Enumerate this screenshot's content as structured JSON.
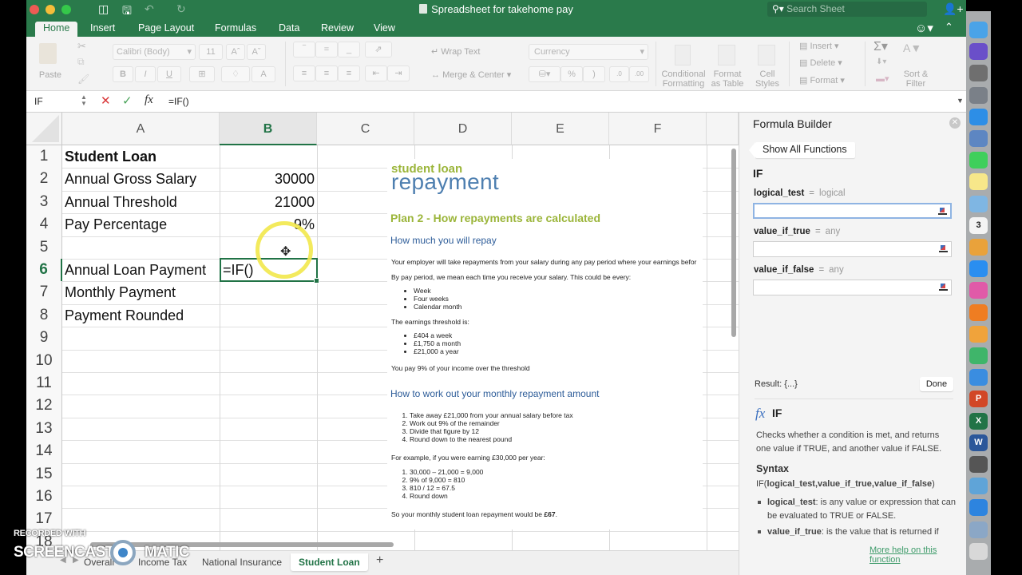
{
  "window": {
    "title": "Spreadsheet for takehome pay",
    "search_placeholder": "Search Sheet"
  },
  "ribbon_tabs": [
    {
      "label": "Home",
      "active": true
    },
    {
      "label": "Insert",
      "active": false
    },
    {
      "label": "Page Layout",
      "active": false
    },
    {
      "label": "Formulas",
      "active": false
    },
    {
      "label": "Data",
      "active": false
    },
    {
      "label": "Review",
      "active": false
    },
    {
      "label": "View",
      "active": false
    }
  ],
  "ribbon": {
    "paste_label": "Paste",
    "font_name": "Calibri (Body)",
    "font_size": "11",
    "bold": "B",
    "italic": "I",
    "underline": "U",
    "wrap_text": "Wrap Text",
    "merge_center": "Merge & Center",
    "number_format": "Currency",
    "percent": "%",
    "comma": ")",
    "conditional_formatting": [
      "Conditional",
      "Formatting"
    ],
    "format_as_table": [
      "Format",
      "as Table"
    ],
    "cell_styles": [
      "Cell",
      "Styles"
    ],
    "insert": "Insert",
    "delete": "Delete",
    "format": "Format",
    "autosum": "Σ",
    "sort_filter": [
      "Sort &",
      "Filter"
    ]
  },
  "formula_bar": {
    "name_box": "IF",
    "formula": "=IF()"
  },
  "sheet": {
    "columns": [
      "A",
      "B",
      "C",
      "D",
      "E",
      "F"
    ],
    "selected_column": "B",
    "selected_row": 6,
    "rows": [
      "1",
      "2",
      "3",
      "4",
      "5",
      "6",
      "7",
      "8",
      "9",
      "10",
      "11",
      "12",
      "13",
      "14",
      "15",
      "16",
      "17",
      "18"
    ],
    "cells": {
      "A1": "Student Loan",
      "A2": "Annual Gross Salary",
      "B2": "30000",
      "A3": "Annual Threshold",
      "B3": "21000",
      "A4": "Pay Percentage",
      "B4": "9%",
      "A6": "Annual Loan Payment",
      "B6": "=IF()",
      "A7": "Monthly Payment",
      "A8": "Payment Rounded"
    }
  },
  "embedded_image": {
    "brand_line1": "student loan",
    "brand_line2": "repayment",
    "heading": "Plan 2 - How repayments are calculated",
    "sub1": "How much you will repay",
    "p1": "Your employer will take repayments from your salary during any pay period where your earnings befor",
    "p2": "By pay period, we mean each time you receive your salary. This could be every:",
    "periods": [
      "Week",
      "Four weeks",
      "Calendar month"
    ],
    "p3": "The earnings threshold is:",
    "thresholds": [
      "£404 a week",
      "£1,750 a month",
      "£21,000 a year"
    ],
    "p4": "You pay 9% of your income over the threshold",
    "sub2": "How to work out your monthly repayment amount",
    "steps": [
      "Take away £21,000 from your annual salary before tax",
      "Work out 9% of the remainder",
      "Divide that figure by 12",
      "Round down to the nearest pound"
    ],
    "p5": "For example, if you were earning £30,000 per year:",
    "example": [
      "30,000 – 21,000 = 9,000",
      "9% of 9,000 = 810",
      "810 / 12 = 67.5",
      "Round down"
    ],
    "p6_prefix": "So your monthly student loan repayment would be ",
    "p6_amount": "£67",
    "p6_suffix": "."
  },
  "sheet_tabs": [
    {
      "label": "Overall",
      "active": false
    },
    {
      "label": "Income Tax",
      "active": false
    },
    {
      "label": "National Insurance",
      "active": false
    },
    {
      "label": "Student Loan",
      "active": true
    }
  ],
  "formula_builder": {
    "title": "Formula Builder",
    "back_label": "Show All Functions",
    "function_name": "IF",
    "args": [
      {
        "name": "logical_test",
        "type": "logical",
        "value": ""
      },
      {
        "name": "value_if_true",
        "type": "any",
        "value": ""
      },
      {
        "name": "value_if_false",
        "type": "any",
        "value": ""
      }
    ],
    "result_label": "Result: {...}",
    "done_label": "Done",
    "help_name": "IF",
    "description": "Checks whether a condition is met, and returns one value if TRUE, and another value if FALSE.",
    "syntax_heading": "Syntax",
    "syntax_fn": "IF(",
    "syntax_args": "logical_test,value_if_true,value_if_false",
    "syntax_close": ")",
    "bullets": [
      {
        "term": "logical_test",
        "text": ": is any value or expression that can be evaluated to TRUE or FALSE."
      },
      {
        "term": "value_if_true",
        "text": ": is the value that is returned if"
      }
    ],
    "more_help": "More help on this function"
  },
  "watermark": {
    "line1": "RECORDED WITH",
    "line2_left": "SCREENCAST",
    "line2_right": "MATIC"
  },
  "dock_apps": [
    "Finder",
    "Siri",
    "System Preferences",
    "Launchpad",
    "Safari",
    "Preview",
    "FaceTime",
    "Notes",
    "Maps",
    "Calendar",
    "Photos",
    "App Store",
    "iTunes",
    "iBooks",
    "Pages",
    "Numbers",
    "Keynote",
    "PowerPoint",
    "Excel",
    "Word",
    "Screenshot",
    "Screencast-O-Matic",
    "Bluetooth",
    "Image Capture",
    "Trash"
  ],
  "dock_calendar_day": "3"
}
